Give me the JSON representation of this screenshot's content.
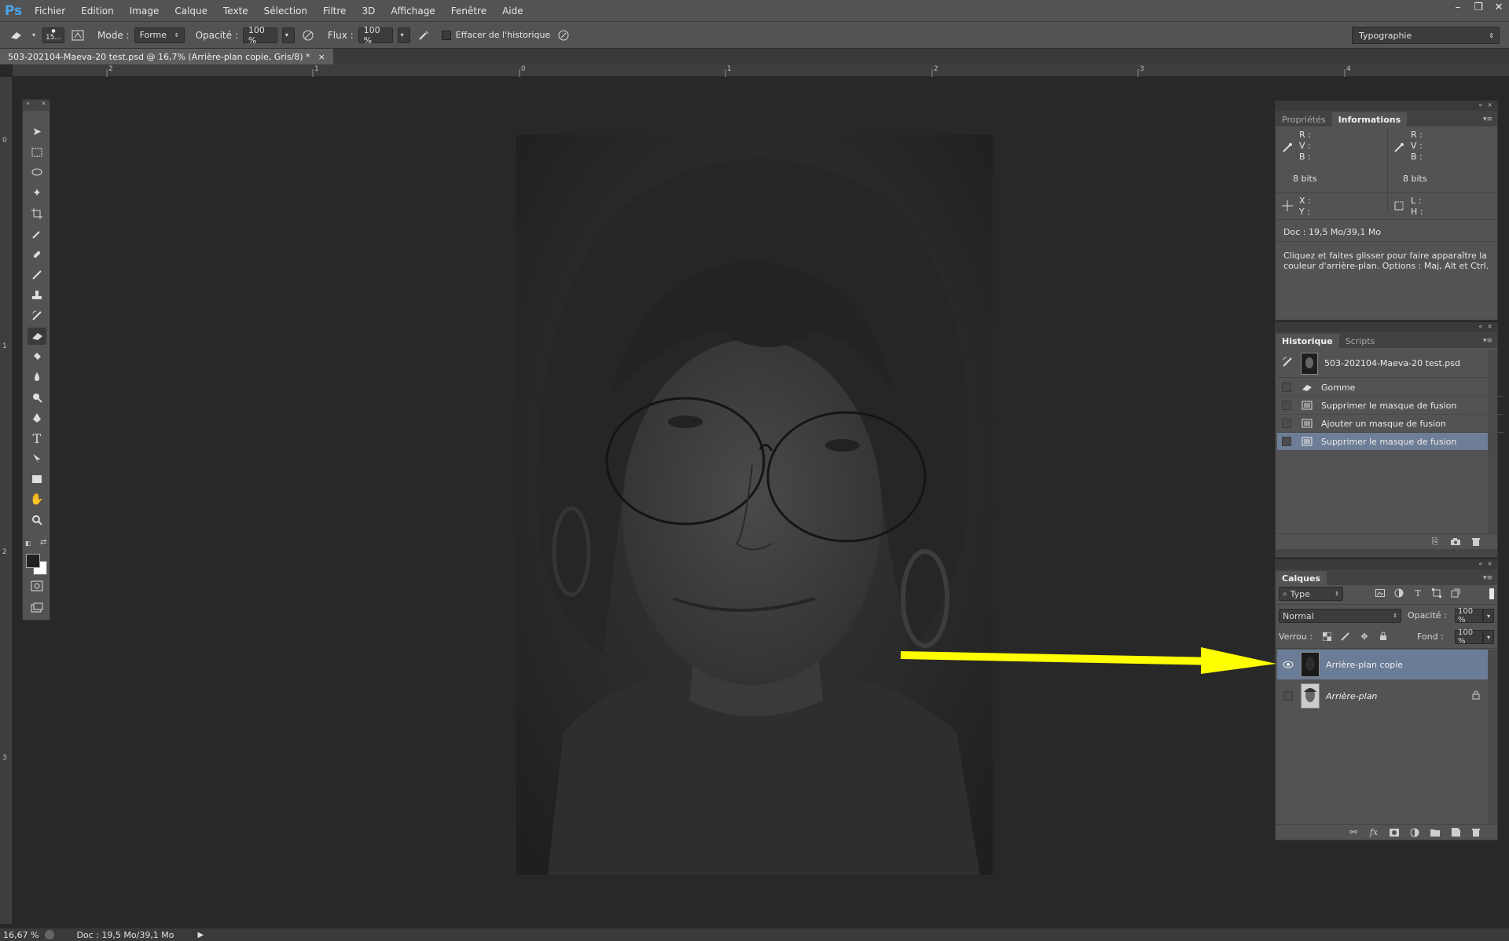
{
  "app": {
    "logo": "Ps"
  },
  "menu": [
    "Fichier",
    "Edition",
    "Image",
    "Calque",
    "Texte",
    "Sélection",
    "Filtre",
    "3D",
    "Affichage",
    "Fenêtre",
    "Aide"
  ],
  "window_controls": {
    "minimize": "–",
    "restore": "❐",
    "close": "✕"
  },
  "options": {
    "brush_size": "15...",
    "mode_label": "Mode :",
    "mode_value": "Forme",
    "opacity_label": "Opacité :",
    "opacity_value": "100 %",
    "flow_label": "Flux :",
    "flow_value": "100 %",
    "erase_history_label": "Effacer de l'historique",
    "workspace": "Typographie"
  },
  "document": {
    "tab_title": "503-202104-Maeva-20 test.psd @ 16,7% (Arrière-plan copie, Gris/8) *",
    "tab_close": "×"
  },
  "rulers": {
    "top": [
      "2",
      "1",
      "0",
      "1",
      "2",
      "3",
      "4"
    ],
    "left": [
      "0",
      "1",
      "2",
      "3"
    ]
  },
  "info_panel": {
    "tabs": [
      "Propriétés",
      "Informations"
    ],
    "rvb_labels": [
      "R :",
      "V :",
      "B :"
    ],
    "bits_left": "8 bits",
    "bits_right": "8 bits",
    "xy_labels": [
      "X :",
      "Y :"
    ],
    "lh_labels": [
      "L :",
      "H :"
    ],
    "doc": "Doc : 19,5 Mo/39,1 Mo",
    "hint": "Cliquez et faites glisser pour faire apparaître la couleur d'arrière-plan. Options : Maj, Alt et Ctrl."
  },
  "history_panel": {
    "tabs": [
      "Historique",
      "Scripts"
    ],
    "snapshot": "503-202104-Maeva-20 test.psd",
    "items": [
      "Gomme",
      "Supprimer le masque de fusion",
      "Ajouter un masque de fusion",
      "Supprimer le masque de fusion"
    ],
    "selected_index": 3
  },
  "layers_panel": {
    "tab": "Calques",
    "filter_label": "Type",
    "blend_mode": "Normal",
    "opacity_label": "Opacité :",
    "opacity_value": "100 %",
    "lock_label": "Verrou :",
    "fill_label": "Fond :",
    "fill_value": "100 %",
    "layers": [
      {
        "name": "Arrière-plan copie",
        "visible": true,
        "selected": true
      },
      {
        "name": "Arrière-plan",
        "visible": false,
        "selected": false,
        "locked": true
      }
    ]
  },
  "status": {
    "zoom": "16,67 %",
    "doc": "Doc : 19,5 Mo/39,1 Mo"
  },
  "colors": {
    "annotation_arrow": "#ffff00",
    "selection": "#6a7c96",
    "panel": "#535353"
  }
}
